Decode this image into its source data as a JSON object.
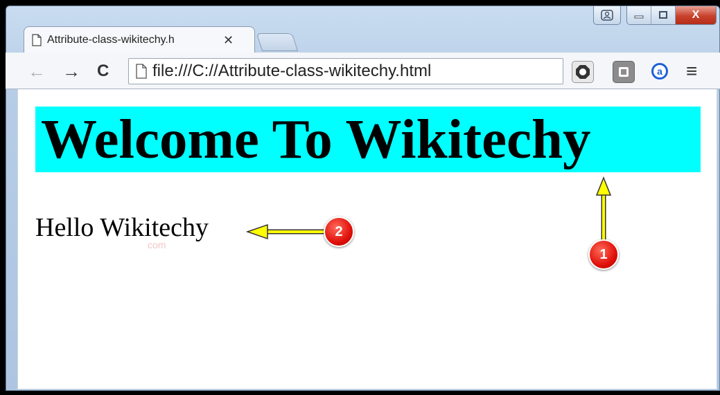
{
  "window": {
    "tab": {
      "title": "Attribute-class-wikitechy.h",
      "close": "✕"
    },
    "caption": {
      "minimize": "—",
      "maximize": "▢",
      "close": "X"
    }
  },
  "toolbar": {
    "back": "←",
    "forward": "→",
    "reload": "C",
    "menu": "≡",
    "address": "file:///C://Attribute-class-wikitechy.html"
  },
  "extensions": {
    "adblock": "O",
    "pocket": "◨",
    "amazon": "a"
  },
  "page": {
    "heading": "Welcome To Wikitechy",
    "paragraph": "Hello Wikitechy",
    "watermark": "com"
  },
  "annotations": [
    {
      "number": "1"
    },
    {
      "number": "2"
    }
  ],
  "colors": {
    "heading_bg": "#00ffff",
    "arrow": "#ffff00",
    "badge": "#e0110a"
  }
}
